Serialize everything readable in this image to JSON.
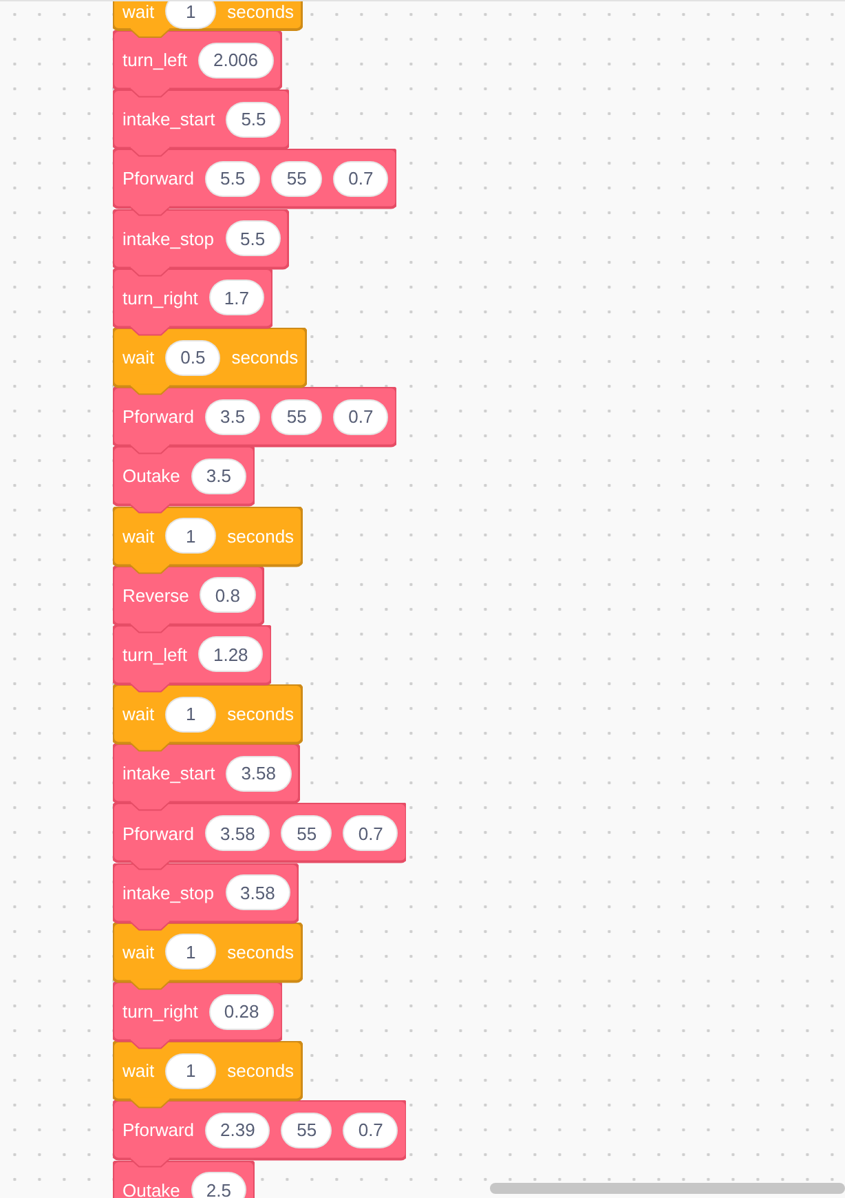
{
  "blocks": [
    {
      "kind": "wait",
      "label": "wait",
      "inputs": [
        "1"
      ],
      "unit": "seconds"
    },
    {
      "kind": "custom",
      "label": "turn_left",
      "inputs": [
        "2.006"
      ]
    },
    {
      "kind": "custom",
      "label": "intake_start",
      "inputs": [
        "5.5"
      ]
    },
    {
      "kind": "custom",
      "label": "Pforward",
      "inputs": [
        "5.5",
        "55",
        "0.7"
      ]
    },
    {
      "kind": "custom",
      "label": "intake_stop",
      "inputs": [
        "5.5"
      ]
    },
    {
      "kind": "custom",
      "label": "turn_right",
      "inputs": [
        "1.7"
      ]
    },
    {
      "kind": "wait",
      "label": "wait",
      "inputs": [
        "0.5"
      ],
      "unit": "seconds"
    },
    {
      "kind": "custom",
      "label": "Pforward",
      "inputs": [
        "3.5",
        "55",
        "0.7"
      ]
    },
    {
      "kind": "custom",
      "label": "Outake",
      "inputs": [
        "3.5"
      ]
    },
    {
      "kind": "wait",
      "label": "wait",
      "inputs": [
        "1"
      ],
      "unit": "seconds"
    },
    {
      "kind": "custom",
      "label": "Reverse",
      "inputs": [
        "0.8"
      ]
    },
    {
      "kind": "custom",
      "label": "turn_left",
      "inputs": [
        "1.28"
      ]
    },
    {
      "kind": "wait",
      "label": "wait",
      "inputs": [
        "1"
      ],
      "unit": "seconds"
    },
    {
      "kind": "custom",
      "label": "intake_start",
      "inputs": [
        "3.58"
      ]
    },
    {
      "kind": "custom",
      "label": "Pforward",
      "inputs": [
        "3.58",
        "55",
        "0.7"
      ]
    },
    {
      "kind": "custom",
      "label": "intake_stop",
      "inputs": [
        "3.58"
      ]
    },
    {
      "kind": "wait",
      "label": "wait",
      "inputs": [
        "1"
      ],
      "unit": "seconds"
    },
    {
      "kind": "custom",
      "label": "turn_right",
      "inputs": [
        "0.28"
      ]
    },
    {
      "kind": "wait",
      "label": "wait",
      "inputs": [
        "1"
      ],
      "unit": "seconds"
    },
    {
      "kind": "custom",
      "label": "Pforward",
      "inputs": [
        "2.39",
        "55",
        "0.7"
      ]
    },
    {
      "kind": "custom",
      "label": "Outake",
      "inputs": [
        "2.5"
      ]
    }
  ]
}
